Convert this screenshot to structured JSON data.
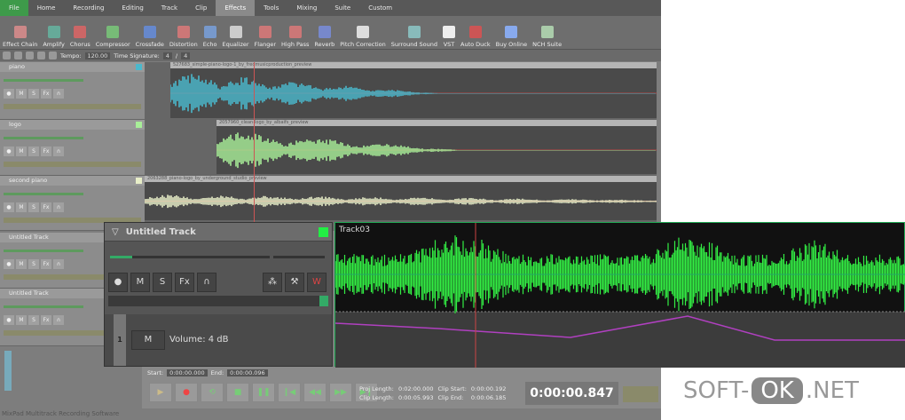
{
  "tabs": [
    "File",
    "Home",
    "Recording",
    "Editing",
    "Track",
    "Clip",
    "Effects",
    "Tools",
    "Mixing",
    "Suite",
    "Custom"
  ],
  "active_tab": "Effects",
  "ribbon": [
    "Effect Chain",
    "Amplify",
    "Chorus",
    "Compressor",
    "Crossfade",
    "Distortion",
    "Echo",
    "Equalizer",
    "Flanger",
    "High Pass",
    "Reverb",
    "Pitch Correction",
    "Surround Sound",
    "VST",
    "Auto Duck",
    "Buy Online",
    "NCH Suite"
  ],
  "toolbar": {
    "tempo_label": "Tempo:",
    "tempo": "120.00",
    "timesig_label": "Time Signature:",
    "ts_num": "4",
    "ts_den": "4"
  },
  "tracks": [
    {
      "name": "piano",
      "clip": "527683_simple-piano-logo-1_by_fredmusicproduction_preview",
      "color": "#4bb8cc"
    },
    {
      "name": "logo",
      "clip": "2057960_clean-logo_by_albaifs_preview",
      "color": "#a8ee98"
    },
    {
      "name": "second piano",
      "clip": "2063288_piano-logo_by_underground_studio_preview",
      "color": "#e8eec8"
    },
    {
      "name": "Untitled Track",
      "clip": "",
      "color": ""
    },
    {
      "name": "Untitled Track",
      "clip": "",
      "color": ""
    }
  ],
  "track_buttons": [
    "M",
    "S",
    "Fx"
  ],
  "panel": {
    "title": "Untitled Track",
    "buttons": [
      "M",
      "S",
      "Fx"
    ],
    "lane_number": "1",
    "lane_button": "M",
    "lane_label": "Volume: 4 dB"
  },
  "wave": {
    "title": "Track03",
    "color": "#33ee44",
    "envelope_color": "#b040c0"
  },
  "transport": {
    "start_label": "Start:",
    "start": "0:00:00.000",
    "end_label": "End:",
    "end": "0:00:00.096",
    "proj_length_label": "Proj Length:",
    "proj_length": "0:02:00.000",
    "clip_length_label": "Clip Length:",
    "clip_length": "0:00:05.993",
    "clip_start_label": "Clip Start:",
    "clip_start": "0:00:00.192",
    "clip_end_label": "Clip End:",
    "clip_end": "0:00:06.185",
    "time": "0:00:00.847"
  },
  "status": "MixPad Multitrack Recording Software",
  "watermark": {
    "pre": "SOFT-",
    "ok": "OK",
    ".net": ".NET"
  }
}
